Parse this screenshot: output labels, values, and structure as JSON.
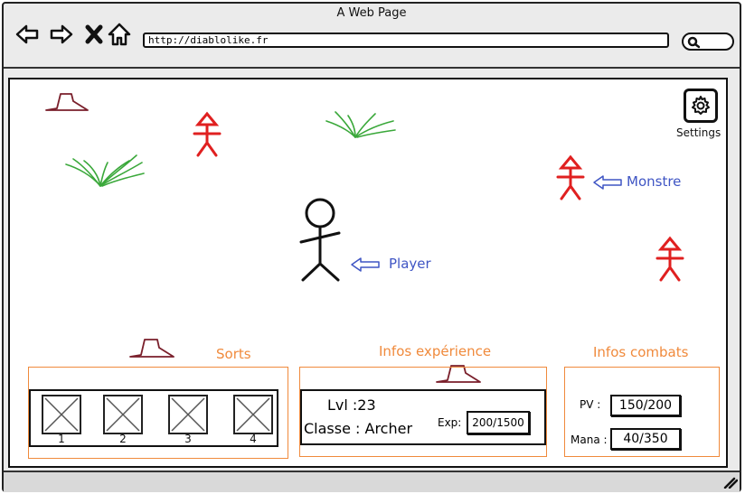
{
  "window": {
    "title": "A Web Page"
  },
  "browser": {
    "url": "http://diablolike.fr",
    "nav_icons": [
      "back-icon",
      "forward-icon",
      "close-icon",
      "home-icon"
    ],
    "search_icon": "search-icon"
  },
  "game": {
    "settings": {
      "label": "Settings",
      "icon": "gear-icon"
    },
    "annotations": {
      "monster": "Monstre",
      "player": "Player"
    }
  },
  "hud": {
    "spells": {
      "title": "Sorts",
      "slots": [
        {
          "label": "1"
        },
        {
          "label": "2"
        },
        {
          "label": "3"
        },
        {
          "label": "4"
        }
      ]
    },
    "experience": {
      "title": "Infos expérience",
      "level": "Lvl :23",
      "class": "Classe : Archer",
      "exp_label": "Exp:",
      "exp_value": "200/1500"
    },
    "combat": {
      "title": "Infos combats",
      "hp_label": "PV :",
      "hp_value": "150/200",
      "mana_label": "Mana :",
      "mana_value": "40/350"
    }
  },
  "colors": {
    "accent": "#f08a3c",
    "monster": "#e02020",
    "grass": "#3aa83a",
    "rock": "#7a1f2b",
    "annotation": "#3f55c4"
  }
}
